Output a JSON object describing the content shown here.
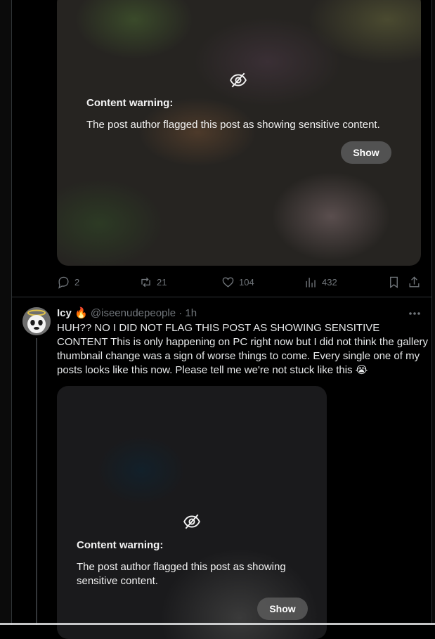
{
  "post1": {
    "content_warning": {
      "title": "Content warning:",
      "text": "The post author flagged this post as showing sensitive content.",
      "show_label": "Show"
    },
    "actions": {
      "replies": "2",
      "reposts": "21",
      "likes": "104",
      "views": "432"
    }
  },
  "post2": {
    "author": {
      "name": "Icy",
      "emoji": "🔥",
      "handle": "@iseenudepeople",
      "separator": "·",
      "time": "1h"
    },
    "text": "HUH?? NO I DID NOT FLAG THIS POST AS SHOWING SENSITIVE CONTENT This is only happening on PC right now but I did not think the gallery thumbnail change was a sign of worse things to come. Every single one of my posts looks like this now. Please tell me we're not stuck like this 😭",
    "content_warning": {
      "title": "Content warning:",
      "text": "The post author flagged this post as showing sensitive content.",
      "show_label": "Show"
    }
  },
  "colors": {
    "background": "#000000",
    "text": "#e7e9ea",
    "muted": "#71767b",
    "divider": "#2f3336"
  },
  "icons": [
    "eye-slash-icon",
    "reply-icon",
    "repost-icon",
    "like-icon",
    "views-icon",
    "bookmark-icon",
    "share-icon",
    "more-icon"
  ]
}
